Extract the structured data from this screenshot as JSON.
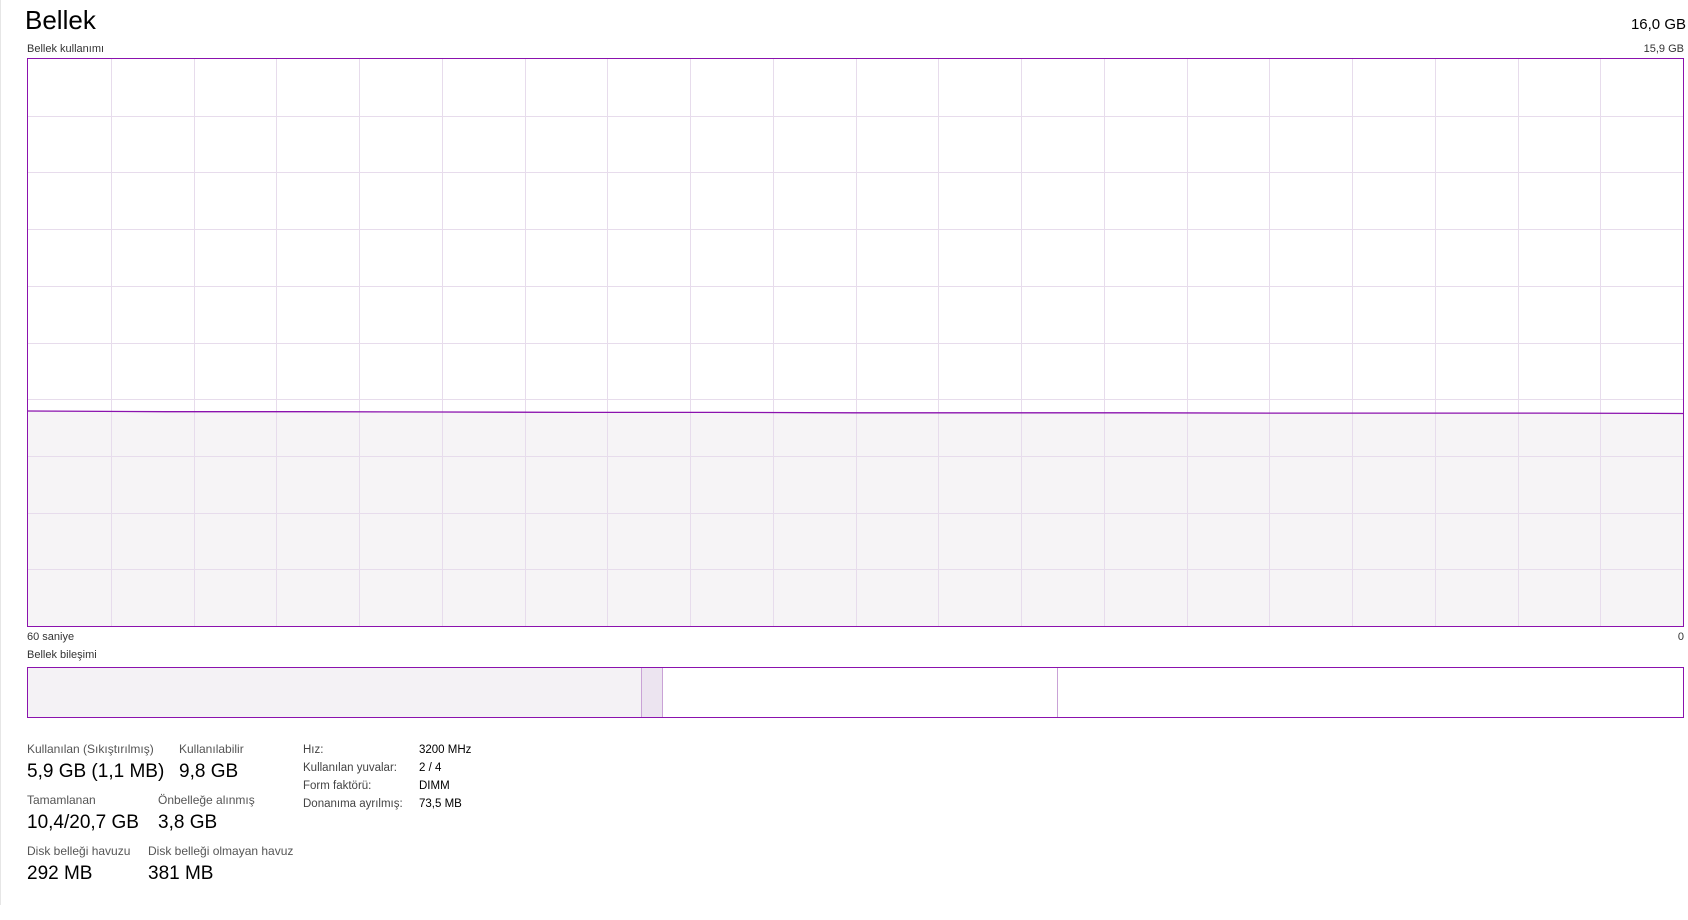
{
  "header": {
    "title": "Bellek",
    "total_capacity": "16,0 GB"
  },
  "usage_chart": {
    "label": "Bellek kullanımı",
    "max_label": "15,9 GB",
    "time_left_label": "60 saniye",
    "time_right_label": "0",
    "line_color": "#8b12ae",
    "fill_color": "#f4f2f5",
    "grid_color": "#e7dcec"
  },
  "chart_data": {
    "type": "area",
    "ylim": [
      0,
      15.9
    ],
    "xlim": [
      60,
      0
    ],
    "x": [
      60,
      55,
      50,
      45,
      40,
      35,
      30,
      25,
      20,
      15,
      10,
      5,
      0
    ],
    "values": [
      6.03,
      6.01,
      6.01,
      6.0,
      5.99,
      5.99,
      5.98,
      5.98,
      5.98,
      5.97,
      5.97,
      5.97,
      5.96
    ],
    "grid": true
  },
  "composition": {
    "label": "Bellek bileşimi",
    "segments": [
      {
        "name": "in-use",
        "value_gb": 5.9
      },
      {
        "name": "modified",
        "value_gb": 0.2
      },
      {
        "name": "standby",
        "value_gb": 3.8
      },
      {
        "name": "free",
        "value_gb": 6.0
      }
    ]
  },
  "stats": {
    "in_use": {
      "label": "Kullanılan (Sıkıştırılmış)",
      "value": "5,9 GB (1,1 MB)"
    },
    "available": {
      "label": "Kullanılabilir",
      "value": "9,8 GB"
    },
    "committed": {
      "label": "Tamamlanan",
      "value": "10,4/20,7 GB"
    },
    "cached": {
      "label": "Önbelleğe alınmış",
      "value": "3,8 GB"
    },
    "paged_pool": {
      "label": "Disk belleği havuzu",
      "value": "292 MB"
    },
    "nonpaged_pool": {
      "label": "Disk belleği olmayan havuz",
      "value": "381 MB"
    }
  },
  "properties": {
    "speed": {
      "key": "Hız:",
      "value": "3200 MHz"
    },
    "slots": {
      "key": "Kullanılan yuvalar:",
      "value": "2 / 4"
    },
    "form_factor": {
      "key": "Form faktörü:",
      "value": "DIMM"
    },
    "reserved": {
      "key": "Donanıma ayrılmış:",
      "value": "73,5 MB"
    }
  }
}
